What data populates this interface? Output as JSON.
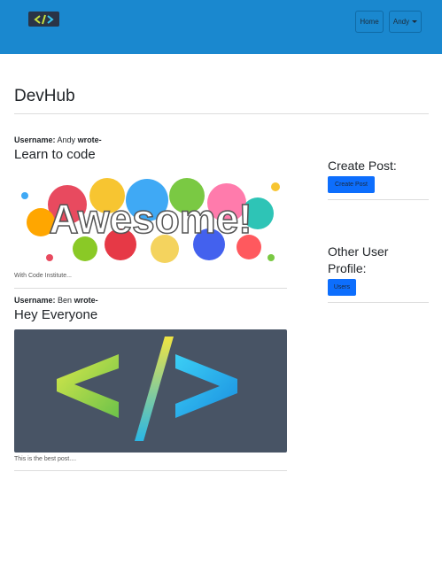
{
  "navbar": {
    "logo_alt": "code-logo-icon",
    "home_label": "Home",
    "user_label": "Andy"
  },
  "page": {
    "title": "DevHub"
  },
  "posts": [
    {
      "username_label": "Username:",
      "username": "Andy",
      "wrote_label": "wrote-",
      "title": "Learn to code",
      "image_text": "Awesome!",
      "caption": "With Code Institute..."
    },
    {
      "username_label": "Username:",
      "username": "Ben",
      "wrote_label": "wrote-",
      "title": "Hey Everyone",
      "image_text": "</>",
      "caption": "This is the best post...."
    }
  ],
  "sidebar": {
    "create_heading": "Create Post:",
    "create_button": "Create Post",
    "profile_heading": "Other User Profile:",
    "users_button": "Users"
  },
  "colors": {
    "navbar": "#1a88cf",
    "button": "#0d6efd",
    "code_image_bg": "#485465"
  }
}
